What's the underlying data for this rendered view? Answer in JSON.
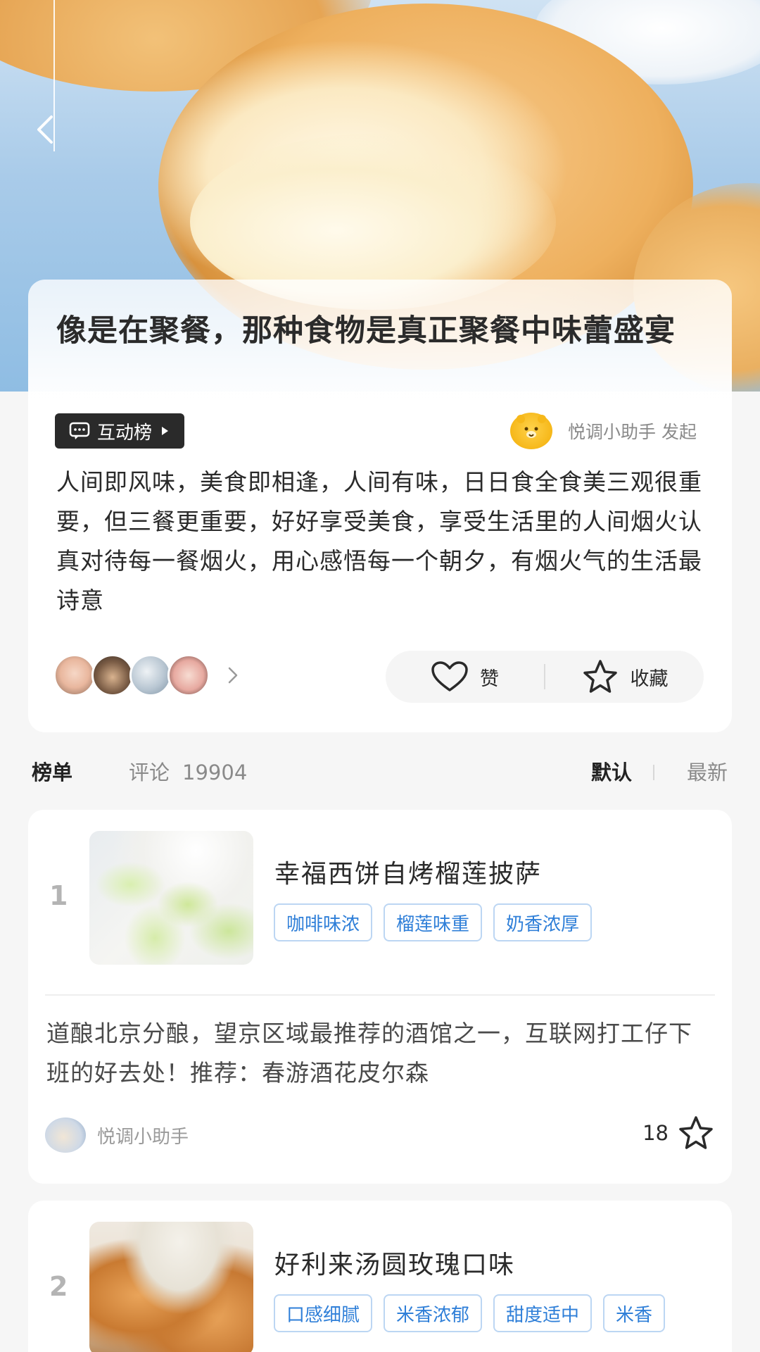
{
  "header": {
    "back_icon": "chevron-left-icon"
  },
  "topic": {
    "title": "像是在聚餐，那种食物是真正聚餐中味蕾盛宴",
    "badge_label": "互动榜",
    "initiator": "悦调小助手 发起",
    "description": "人间即风味，美食即相逢，人间有味，日日食全食美三观很重要，但三餐更重要，好好享受美食，享受生活里的人间烟火认真对待每一餐烟火，用心感悟每一个朝夕，有烟火气的生活最诗意",
    "like_label": "赞",
    "favorite_label": "收藏"
  },
  "tabs": {
    "ranking": "榜单",
    "comments_label": "评论",
    "comments_count": "19904",
    "sort_default": "默认",
    "sort_latest": "最新"
  },
  "rank_items": [
    {
      "rank": "1",
      "title": "幸福西饼自烤榴莲披萨",
      "tags": [
        "咖啡味浓",
        "榴莲味重",
        "奶香浓厚"
      ],
      "comment": "道酿北京分酿，望京区域最推荐的酒馆之一，互联网打工仔下班的好去处！推荐：春游酒花皮尔森",
      "author": "悦调小助手",
      "likes": "18"
    },
    {
      "rank": "2",
      "title": "好利来汤圆玫瑰口味",
      "tags": [
        "口感细腻",
        "米香浓郁",
        "甜度适中",
        "米香"
      ]
    }
  ],
  "colors": {
    "accent_blue": "#2f7fd8",
    "tag_border": "#bcd6f3",
    "badge_bg": "#2a2a2a"
  }
}
